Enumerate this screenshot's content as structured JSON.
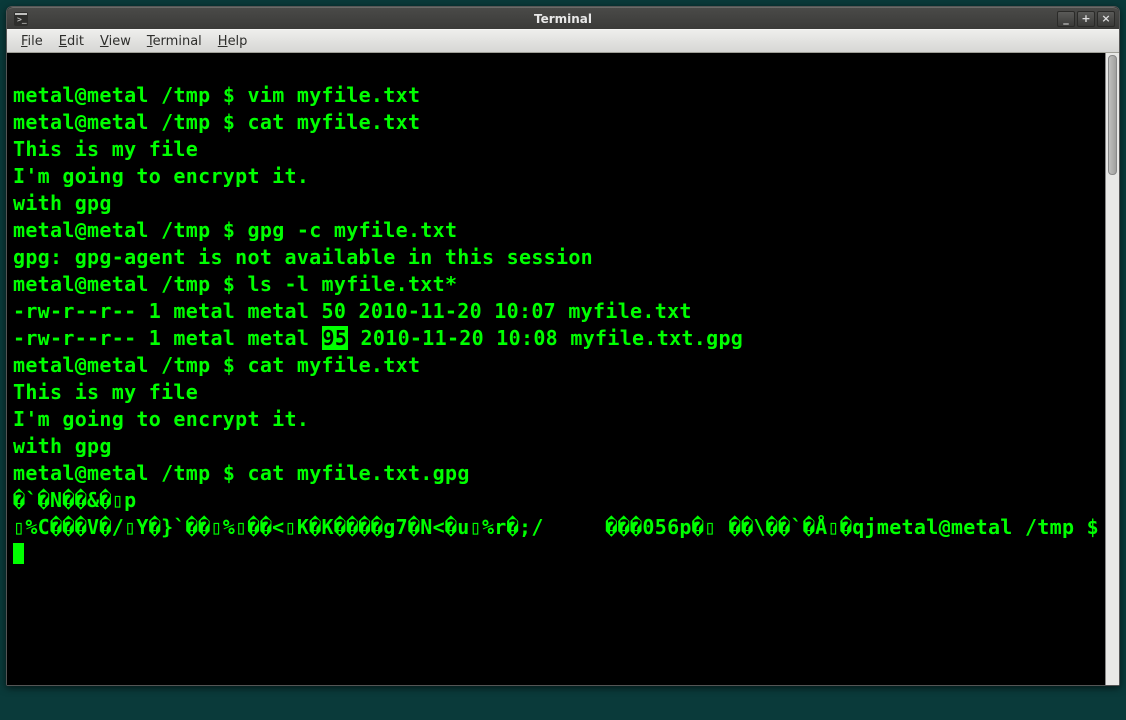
{
  "window": {
    "title": "Terminal",
    "minimize_label": "_",
    "maximize_label": "+",
    "close_label": "×"
  },
  "menubar": {
    "items": [
      {
        "label": "File"
      },
      {
        "label": "Edit"
      },
      {
        "label": "View"
      },
      {
        "label": "Terminal"
      },
      {
        "label": "Help"
      }
    ]
  },
  "prompt": {
    "userhost": "metal@metal",
    "path": "/tmp",
    "symbol": "$"
  },
  "lines": {
    "cmd1": "vim myfile.txt",
    "cmd2": "cat myfile.txt",
    "file_line1": "This is my file",
    "file_line2": "I'm going to encrypt it.",
    "file_line3": "with gpg",
    "cmd3": "gpg -c myfile.txt",
    "gpg_warn": "gpg: gpg-agent is not available in this session",
    "cmd4": "ls -l myfile.txt*",
    "ls1_pre": "-rw-r--r-- 1 metal metal 50 2010-11-20 10:07 myfile.txt",
    "ls2_pre": "-rw-r--r-- 1 metal metal ",
    "ls2_hl": "95",
    "ls2_post": " 2010-11-20 10:08 myfile.txt.gpg",
    "cmd5": "cat myfile.txt",
    "cmd6": "cat myfile.txt.gpg",
    "bin1": "�`�N��&�▯p",
    "bin2": "▯%C���V�/▯Y�}`��▯%▯��<▯K�K����g7�N<�u▯%r�;/     ���056p�▯ ��\\��`�Å▯�qj",
    "prompt_wrap": "metal@metal /tmp $ "
  }
}
